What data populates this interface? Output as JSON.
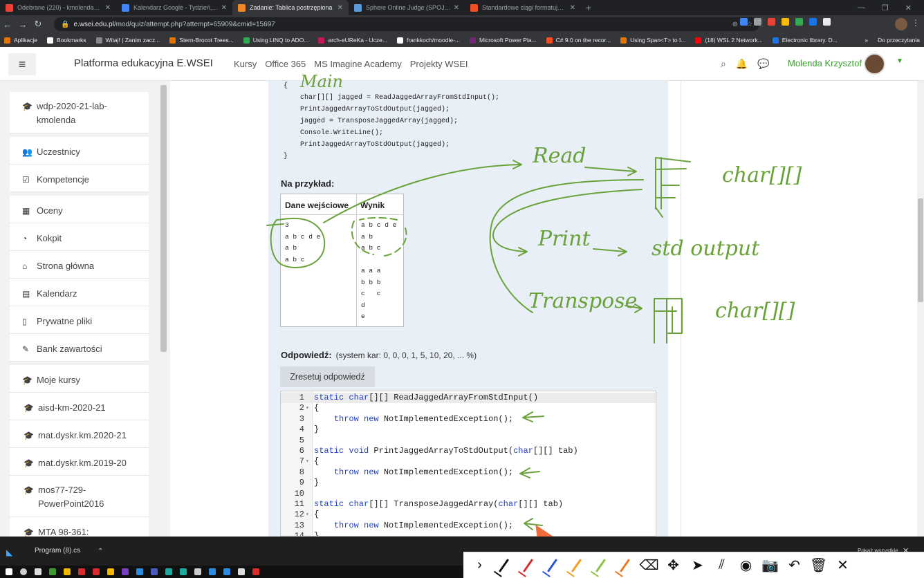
{
  "browser": {
    "tabs": [
      {
        "title": "Odebrane (220) - kmolenda@gm",
        "fav": "#ea4335"
      },
      {
        "title": "Kalendarz Google - Tydzień, w k",
        "fav": "#4285f4"
      },
      {
        "title": "Zadanie: Tablica postrzępiona",
        "fav": "#f08a24",
        "active": true
      },
      {
        "title": "Sphere Online Judge (SPOJ) - Stc",
        "fav": "#5a9bd8"
      },
      {
        "title": "Standardowe ciągi formatujące l",
        "fav": "#f25022"
      }
    ],
    "new_tab": "+",
    "url_domain": "e.wsei.edu.pl",
    "url_path": "/mod/quiz/attempt.php?attempt=65909&cmid=15697",
    "bookmarks": [
      {
        "label": "Aplikacje",
        "icon": "#e37400"
      },
      {
        "label": "Bookmarks",
        "icon": "#ffffff"
      },
      {
        "label": "Witaj! | Zanim zacz...",
        "icon": "#888888"
      },
      {
        "label": "Stern-Brocot Trees...",
        "icon": "#e37400"
      },
      {
        "label": "Using LINQ to ADO...",
        "icon": "#34a853"
      },
      {
        "label": "arch-eUReKa - Ucze...",
        "icon": "#c2185b"
      },
      {
        "label": "frankkoch/moodle-...",
        "icon": "#ffffff"
      },
      {
        "label": "Microsoft Power Pla...",
        "icon": "#742774"
      },
      {
        "label": "C# 9.0 on the recor...",
        "icon": "#f25022"
      },
      {
        "label": "Using Span<T> to I...",
        "icon": "#e37400"
      },
      {
        "label": "(18) WSL 2 Network...",
        "icon": "#ff0000"
      },
      {
        "label": "Electronic library. D...",
        "icon": "#1a73e8"
      }
    ],
    "bookmarks_more": "»",
    "reading_list": "Do przeczytania"
  },
  "moodle": {
    "brand": "Platforma edukacyjna E.WSEI",
    "links": [
      "Kursy",
      "Office 365",
      "MS Imagine Academy",
      "Projekty WSEI"
    ],
    "user_name": "Molenda Krzysztof"
  },
  "sidebar": {
    "items": [
      {
        "label": "wdp-2020-21-lab-kmolenda",
        "icon": "graduation-cap-icon",
        "glyph": "🎓"
      },
      {
        "label": "Uczestnicy",
        "icon": "users-icon",
        "glyph": "👥"
      },
      {
        "label": "Kompetencje",
        "icon": "checkbox-icon",
        "glyph": "☑"
      },
      {
        "label": "Oceny",
        "icon": "table-icon",
        "glyph": "▦"
      },
      {
        "label": "Kokpit",
        "icon": "dashboard-icon",
        "glyph": "◔"
      },
      {
        "label": "Strona główna",
        "icon": "home-icon",
        "glyph": "⌂"
      },
      {
        "label": "Kalendarz",
        "icon": "calendar-icon",
        "glyph": "▤"
      },
      {
        "label": "Prywatne pliki",
        "icon": "file-icon",
        "glyph": "▯"
      },
      {
        "label": "Bank zawartości",
        "icon": "brush-icon",
        "glyph": "✎"
      },
      {
        "label": "Moje kursy",
        "icon": "graduation-cap-icon",
        "glyph": "🎓"
      },
      {
        "label": "aisd-km-2020-21",
        "icon": "graduation-cap-icon",
        "glyph": "🎓"
      },
      {
        "label": "mat.dyskr.km.2020-21",
        "icon": "graduation-cap-icon",
        "glyph": "🎓"
      },
      {
        "label": "mat.dyskr.km.2019-20",
        "icon": "graduation-cap-icon",
        "glyph": "🎓"
      },
      {
        "label": "mos77-729-PowerPoint2016",
        "icon": "graduation-cap-icon",
        "glyph": "🎓"
      },
      {
        "label": "MTA 98-361:",
        "icon": "graduation-cap-icon",
        "glyph": "🎓"
      }
    ]
  },
  "question": {
    "main_code": [
      "{",
      "    char[][] jagged = ReadJaggedArrayFromStdInput();",
      "    PrintJaggedArrayToStdOutput(jagged);",
      "    jagged = TransposeJaggedArray(jagged);",
      "    Console.WriteLine();",
      "    PrintJaggedArrayToStdOutput(jagged);",
      "}"
    ],
    "example_label": "Na przykład:",
    "table_headers": [
      "Dane wejściowe",
      "Wynik"
    ],
    "input_lines": [
      "3",
      "a b c d e",
      "a b",
      "a b c"
    ],
    "output_lines": [
      "a b c d e",
      "a b",
      "a b c",
      "",
      "a a a",
      "b b b",
      "c   c",
      "d",
      "e"
    ],
    "answer_label": "Odpowiedź:",
    "penalty": "(system kar: 0, 0, 0, 1, 5, 10, 20, ... %)",
    "reset_label": "Zresetuj odpowiedź"
  },
  "editor": {
    "lines": [
      {
        "n": "1",
        "text": "static char[][] ReadJaggedArrayFromStdInput()"
      },
      {
        "n": "2",
        "text": "{",
        "fold": true
      },
      {
        "n": "3",
        "text": "    throw new NotImplementedException();"
      },
      {
        "n": "4",
        "text": "}"
      },
      {
        "n": "5",
        "text": ""
      },
      {
        "n": "6",
        "text": "static void PrintJaggedArrayToStdOutput(char[][] tab)"
      },
      {
        "n": "7",
        "text": "{",
        "fold": true
      },
      {
        "n": "8",
        "text": "    throw new NotImplementedException();"
      },
      {
        "n": "9",
        "text": "}"
      },
      {
        "n": "10",
        "text": ""
      },
      {
        "n": "11",
        "text": "static char[][] TransposeJaggedArray(char[][] tab)"
      },
      {
        "n": "12",
        "text": "{",
        "fold": true
      },
      {
        "n": "13",
        "text": "    throw new NotImplementedException();"
      },
      {
        "n": "14",
        "text": "}"
      }
    ]
  },
  "annotations": {
    "main": "Main",
    "read": "Read",
    "print": "Print",
    "std_output": "std output",
    "transpose": "Transpose",
    "type1": "char[][]",
    "type2": "char[][]",
    "ink_color": "#6aa23a"
  },
  "taskbar": {
    "download_file": "Program (8).cs",
    "show_all": "Pokaż wszystkie",
    "tool_colors": [
      "#111111",
      "#d92b2b",
      "#2b55d9",
      "#f0a020",
      "#8bc34a",
      "#f07820"
    ]
  }
}
